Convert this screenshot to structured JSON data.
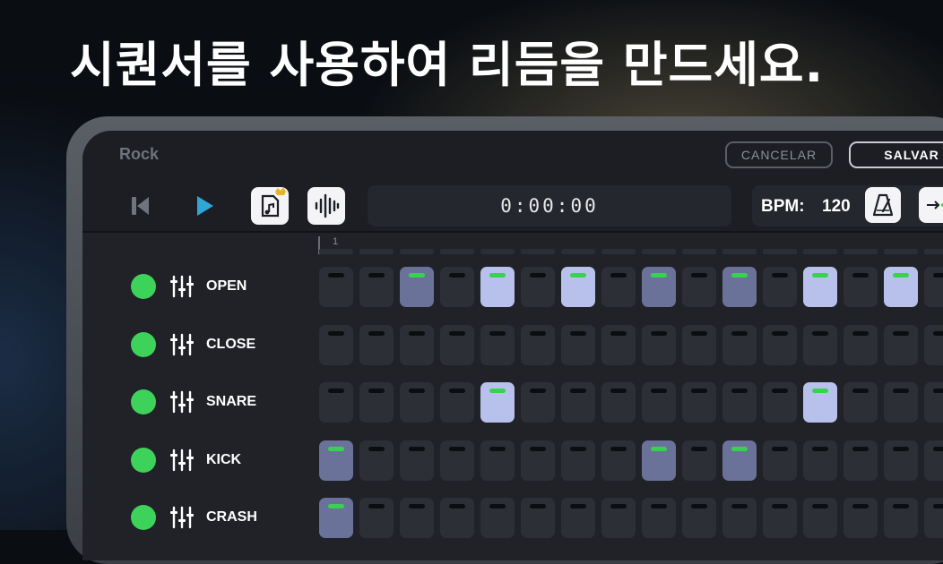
{
  "headline": "시퀀서를 사용하여 리듬을 만드세요.",
  "app": {
    "song_title": "Rock",
    "cancel_label": "CANCELAR",
    "save_label": "SALVAR",
    "timer": "0:00:00",
    "bpm_label": "BPM:",
    "bpm_value": "120",
    "bar_number": "1"
  },
  "controls": [
    {
      "name": "skip-back-icon"
    },
    {
      "name": "play-icon",
      "color": "#2fa6d6"
    },
    {
      "name": "music-file-premium-icon",
      "accent": "#e8b324"
    },
    {
      "name": "waveform-icon"
    },
    {
      "name": "metronome-icon"
    },
    {
      "name": "arrow-right-icon",
      "accent": "#37d24f"
    }
  ],
  "colors": {
    "dot_green": "#3dd35a",
    "pad_off": "#2d2f36",
    "pad_medium": "#6b7299",
    "pad_light": "#b8c1ec",
    "indicator_on": "#37d24f"
  },
  "tracks": [
    {
      "label": "OPEN",
      "pads": [
        0,
        0,
        1,
        0,
        2,
        0,
        2,
        0,
        1,
        0,
        1,
        0,
        2,
        0,
        2,
        0
      ]
    },
    {
      "label": "CLOSE",
      "pads": [
        0,
        0,
        0,
        0,
        0,
        0,
        0,
        0,
        0,
        0,
        0,
        0,
        0,
        0,
        0,
        0
      ]
    },
    {
      "label": "SNARE",
      "pads": [
        0,
        0,
        0,
        0,
        2,
        0,
        0,
        0,
        0,
        0,
        0,
        0,
        2,
        0,
        0,
        0
      ]
    },
    {
      "label": "KICK",
      "pads": [
        1,
        0,
        0,
        0,
        0,
        0,
        0,
        0,
        1,
        0,
        1,
        0,
        0,
        0,
        0,
        0
      ]
    },
    {
      "label": "CRASH",
      "pads": [
        1,
        0,
        0,
        0,
        0,
        0,
        0,
        0,
        0,
        0,
        0,
        0,
        0,
        0,
        0,
        0
      ]
    }
  ]
}
